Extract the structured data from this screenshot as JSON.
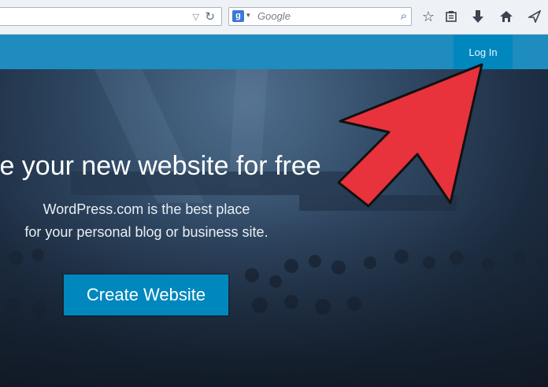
{
  "browser": {
    "search_placeholder": "Google",
    "search_engine_letter": "g"
  },
  "site": {
    "login_label": "Log In"
  },
  "hero": {
    "headline": "te your new website for free",
    "subline_1": "WordPress.com is the best place",
    "subline_2": "for your personal blog or business site.",
    "cta_label": "Create Website"
  },
  "colors": {
    "header_blue": "#1e8cbe",
    "button_blue": "#0087be",
    "arrow_red": "#e8323c"
  },
  "icons": [
    "dropdown-icon",
    "reload-icon",
    "search-icon",
    "bookmark-star-icon",
    "reading-list-icon",
    "download-icon",
    "home-icon",
    "send-icon",
    "annotation-arrow-icon"
  ]
}
